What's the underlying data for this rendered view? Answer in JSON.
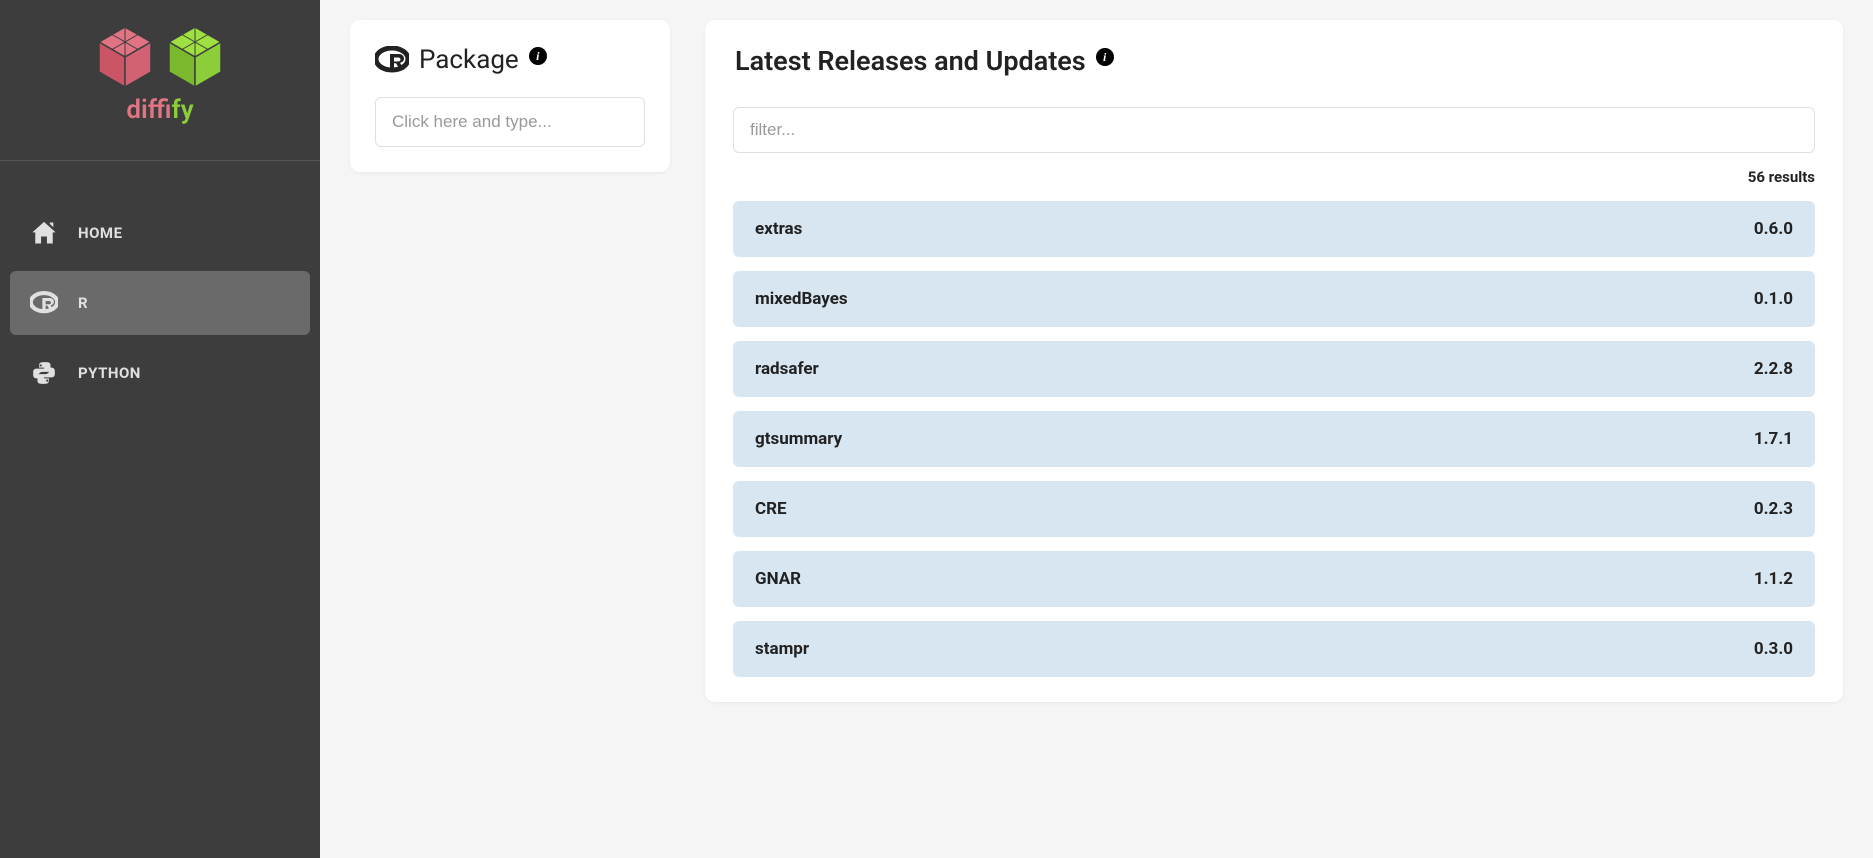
{
  "sidebar": {
    "brand": {
      "part1": "diff",
      "part2": "ify"
    },
    "nav": [
      {
        "label": "HOME",
        "icon": "home-icon"
      },
      {
        "label": "R",
        "icon": "r-icon",
        "active": true
      },
      {
        "label": "PYTHON",
        "icon": "python-icon"
      }
    ]
  },
  "leftPanel": {
    "title": "Package",
    "searchPlaceholder": "Click here and type..."
  },
  "rightPanel": {
    "title": "Latest Releases and Updates",
    "filterPlaceholder": "filter...",
    "resultsCount": "56 results",
    "releases": [
      {
        "name": "extras",
        "version": "0.6.0"
      },
      {
        "name": "mixedBayes",
        "version": "0.1.0"
      },
      {
        "name": "radsafer",
        "version": "2.2.8"
      },
      {
        "name": "gtsummary",
        "version": "1.7.1"
      },
      {
        "name": "CRE",
        "version": "0.2.3"
      },
      {
        "name": "GNAR",
        "version": "1.1.2"
      },
      {
        "name": "stampr",
        "version": "0.3.0"
      }
    ]
  }
}
